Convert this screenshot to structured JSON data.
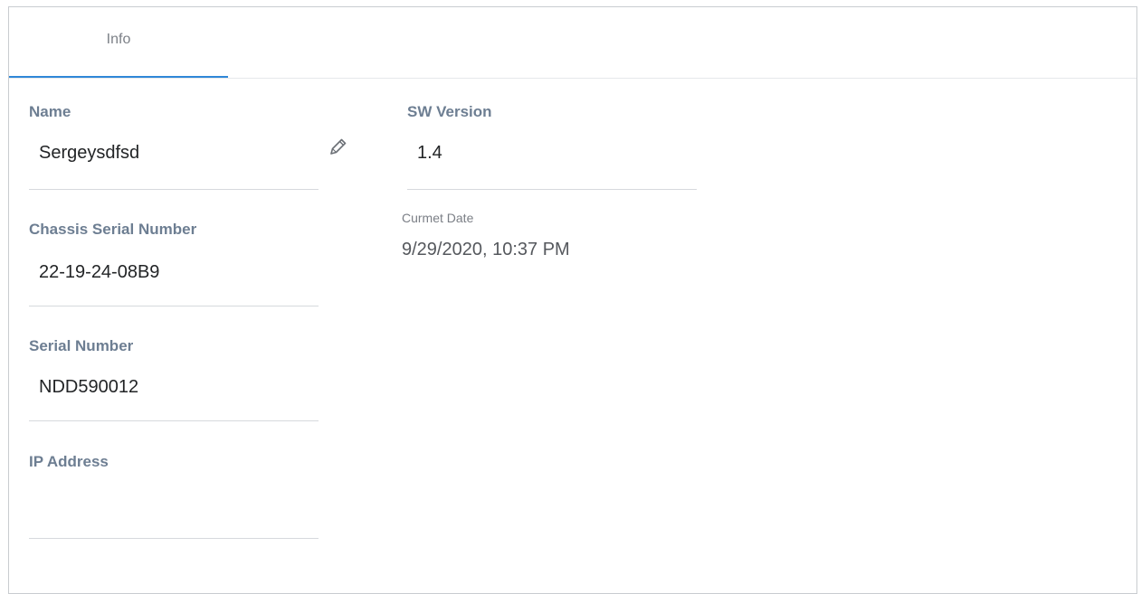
{
  "tabs": [
    {
      "label": "Info",
      "active": true
    }
  ],
  "fields": {
    "name": {
      "label": "Name",
      "value": "Sergeysdfsd"
    },
    "chassis_serial": {
      "label": "Chassis Serial Number",
      "value": "22-19-24-08B9"
    },
    "serial": {
      "label": "Serial Number",
      "value": "NDD590012"
    },
    "ip_address": {
      "label": "IP Address",
      "value": ""
    },
    "sw_version": {
      "label": "SW Version",
      "value": "1.4"
    }
  },
  "current_date": {
    "label": "Curmet Date",
    "value": "9/29/2020, 10:37 PM"
  },
  "icons": {
    "edit": "pencil-icon"
  },
  "colors": {
    "accent": "#2f87d8",
    "label": "#6d7e92",
    "text": "#222426"
  }
}
